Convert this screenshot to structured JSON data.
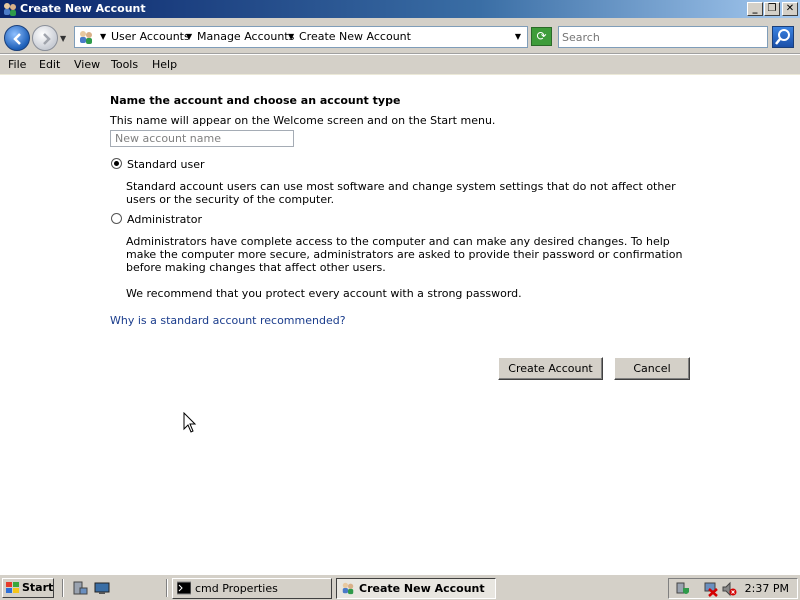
{
  "window": {
    "title": "Create New Account"
  },
  "address_bar": {
    "breadcrumbs": [
      "User Accounts",
      "Manage Accounts",
      "Create New Account"
    ]
  },
  "search": {
    "placeholder": "Search"
  },
  "menu": [
    "File",
    "Edit",
    "View",
    "Tools",
    "Help"
  ],
  "form": {
    "heading": "Name the account and choose an account type",
    "subtext": "This name will appear on the Welcome screen and on the Start menu.",
    "name_placeholder": "New account name",
    "options": [
      {
        "label": "Standard user",
        "checked": true,
        "description": "Standard account users can use most software and change system settings that do not affect other users or the security of the computer."
      },
      {
        "label": "Administrator",
        "checked": false,
        "description": "Administrators have complete access to the computer and can make any desired changes. To help make the computer more secure, administrators are asked to provide their password or confirmation before making changes that affect other users."
      }
    ],
    "recommendation": "We recommend that you protect every account with a strong password.",
    "help_link": "Why is a standard account recommended?",
    "create_button": "Create Account",
    "cancel_button": "Cancel"
  },
  "taskbar": {
    "start_label": "Start",
    "tasks": [
      {
        "label": "cmd Properties",
        "active": false
      },
      {
        "label": "Create New Account",
        "active": true
      }
    ],
    "clock": "2:37 PM"
  },
  "colors": {
    "titlebar_start": "#0a246a",
    "link": "#1a3c8c",
    "chrome": "#d4d0c8"
  }
}
